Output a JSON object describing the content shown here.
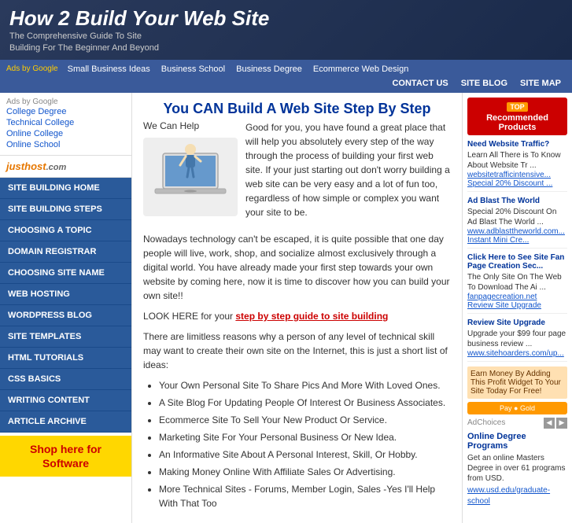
{
  "header": {
    "title": "How 2 Build Your Web Site",
    "subtitle1": "The Comprehensive Guide To Site",
    "subtitle2": "Building For The Beginner And Beyond"
  },
  "navbar": {
    "ads_label": "Ads by Google",
    "links": [
      {
        "label": "Small Business Ideas",
        "url": "#"
      },
      {
        "label": "Business School",
        "url": "#"
      },
      {
        "label": "Business Degree",
        "url": "#"
      },
      {
        "label": "Ecommerce Web Design",
        "url": "#"
      }
    ],
    "right_links": [
      {
        "label": "CONTACT US",
        "url": "#"
      },
      {
        "label": "SITE BLOG",
        "url": "#"
      },
      {
        "label": "SITE MAP",
        "url": "#"
      }
    ]
  },
  "sidebar": {
    "ads_label": "Ads by Google",
    "ad_links": [
      "College Degree",
      "Technical College",
      "Online College",
      "Online School"
    ],
    "justhost_text": "just",
    "justhost_com": "host",
    "justhost_dot": ".com",
    "nav_items": [
      {
        "label": "SITE BUILDING HOME",
        "id": "site-building-home"
      },
      {
        "label": "SITE BUILDING STEPS",
        "id": "site-building-steps"
      },
      {
        "label": "CHOOSING A TOPIC",
        "id": "choosing-topic"
      },
      {
        "label": "DOMAIN REGISTRAR",
        "id": "domain-registrar"
      },
      {
        "label": "CHOOSING SITE NAME",
        "id": "choosing-site-name"
      },
      {
        "label": "WEB HOSTING",
        "id": "web-hosting"
      },
      {
        "label": "WORDPRESS BLOG",
        "id": "wordpress-blog"
      },
      {
        "label": "SITE TEMPLATES",
        "id": "site-templates"
      },
      {
        "label": "HTML TUTORIALS",
        "id": "html-tutorials"
      },
      {
        "label": "CSS BASICS",
        "id": "css-basics"
      },
      {
        "label": "WRITING CONTENT",
        "id": "writing-content"
      },
      {
        "label": "ARTICLE ARCHIVE",
        "id": "article-archive"
      }
    ],
    "shop_line1": "Shop here for",
    "shop_line2": "Software"
  },
  "content": {
    "title": "You CAN Build A Web Site Step By Step",
    "we_can_help": "We Can Help",
    "para1": "Good for you, you have found a great place that will help you absolutely every step of the way through the process of building your first web site. If your just starting out don't worry building a web site can be very easy and a lot of fun too, regardless of how simple or complex you want your site to be.",
    "para2": "Nowadays technology can't be escaped, it is quite possible that one day people will live, work, shop, and socialize almost exclusively through a digital world. You have already made your first step towards your own website by coming here, now it is time to discover how you can build your own site!!",
    "step_link_pre": "LOOK HERE for your ",
    "step_link_text": "step by step guide to site building",
    "para3": "There are limitless reasons why a person of any level of technical skill may want to create their own site on the Internet, this is just a short list of ideas:",
    "list_items": [
      "Your Own Personal Site To Share Pics And More With Loved Ones.",
      "A Site Blog For Updating People Of Interest Or Business Associates.",
      "Ecommerce Site To Sell Your New Product Or Service.",
      "Marketing Site For Your Personal Business Or New Idea.",
      "An Informative Site About A Personal Interest, Skill, Or Hobby.",
      "Making Money Online With Affiliate Sales Or Advertising.",
      "More Technical Sites - Forums, Member Login, Sales -Yes I'll Help With That Too"
    ]
  },
  "rightsidebar": {
    "top_badge": "TOP",
    "rec_title": "Recommended Products",
    "items": [
      {
        "title": "Need Website Traffic?",
        "desc": "Learn All There is To Know About Website Tr ...",
        "link": "websitetrafficintensive...",
        "link_label": "Special 20% Discount ..."
      },
      {
        "title": "Ad Blast The World",
        "desc": "Special 20% Discount On Ad Blast The World ...",
        "link": "www.adblasttheworld.com...",
        "link_label": "Instant Mini Cre..."
      },
      {
        "title": "Click Here to See Site Fan Page Creation Sec...",
        "desc": "The Only Site On The Web To Download The Ai ...",
        "link": "fanpagecreation.net",
        "link_label": "Review Site Upgrade"
      },
      {
        "title": "Review Site Upgrade",
        "desc": "Upgrade your $99 four page business review ...",
        "link": "www.sitehoarders.com/up...",
        "link_label": ""
      }
    ],
    "earn_text": "Earn Money By Adding This Profit Widget To Your Site Today For Free!",
    "adchoices": "AdChoices",
    "online_degree_title": "Online Degree Programs",
    "online_degree_desc": "Get an online Masters Degree in over 61 programs from USD.",
    "online_degree_link": "www.usd.edu/graduate-school"
  }
}
